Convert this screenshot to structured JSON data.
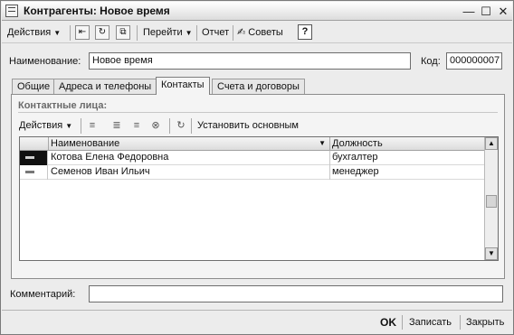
{
  "window": {
    "title": "Контрагенты: Новое время",
    "minimize_icon": "minimize-icon",
    "maximize_icon": "maximize-icon",
    "close_icon": "close-icon"
  },
  "toolbar": {
    "actions_label": "Действия",
    "goto_label": "Перейти",
    "report_label": "Отчет",
    "tips_label": "Советы",
    "help_label": "?"
  },
  "header": {
    "name_label": "Наименование:",
    "name_value": "Новое время",
    "code_label": "Код:",
    "code_value": "000000007"
  },
  "tabs": [
    {
      "label": "Общие"
    },
    {
      "label": "Адреса и телефоны"
    },
    {
      "label": "Контакты",
      "active": true
    },
    {
      "label": "Счета и договоры"
    }
  ],
  "contacts": {
    "group_title": "Контактные лица:",
    "actions_label": "Действия",
    "set_main_label": "Установить основным",
    "columns": [
      "Наименование",
      "Должность"
    ],
    "rows": [
      {
        "name": "Котова Елена Федоровна",
        "position": "бухгалтер",
        "selected": true
      },
      {
        "name": "Семенов Иван Ильич",
        "position": "менеджер",
        "selected": false
      }
    ]
  },
  "comment": {
    "label": "Комментарий:",
    "value": ""
  },
  "footer": {
    "ok_label": "OK",
    "save_label": "Записать",
    "close_label": "Закрыть"
  },
  "colors": {
    "window_bg": "#ececec",
    "selected_marker": "#111111"
  }
}
